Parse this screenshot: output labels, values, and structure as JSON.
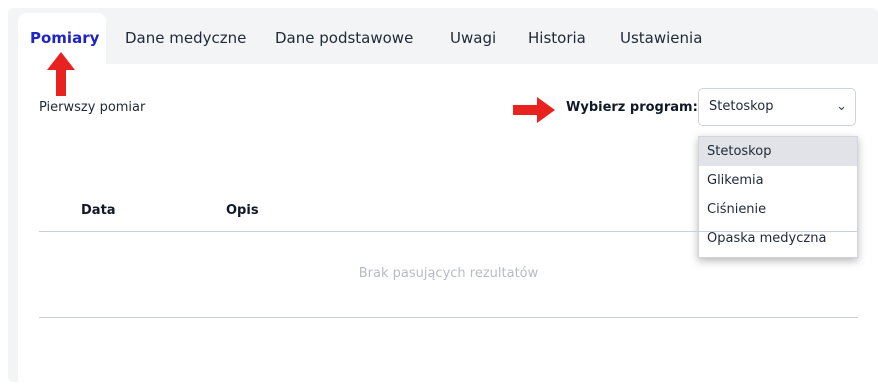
{
  "tabs": [
    {
      "label": "Pomiary",
      "active": true
    },
    {
      "label": "Dane medyczne",
      "active": false
    },
    {
      "label": "Dane podstawowe",
      "active": false
    },
    {
      "label": "Uwagi",
      "active": false
    },
    {
      "label": "Historia",
      "active": false
    },
    {
      "label": "Ustawienia",
      "active": false
    }
  ],
  "main": {
    "first_measurement_label": "Pierwszy pomiar",
    "program_label": "Wybierz program:",
    "program_select": {
      "value": "Stetoskop",
      "options": [
        "Stetoskop",
        "Glikemia",
        "Ciśnienie",
        "Opaska medyczna"
      ],
      "highlighted": "Stetoskop"
    },
    "table": {
      "columns": [
        "Data",
        "Opis"
      ],
      "empty_text": "Brak pasujących rezultatów"
    }
  },
  "annotations": {
    "arrow_color": "#e8231f"
  },
  "colors": {
    "accent": "#1f24c4",
    "frame_bg": "#f3f4f6"
  },
  "icons": {
    "select_chevron": "chevron-down-icon"
  }
}
